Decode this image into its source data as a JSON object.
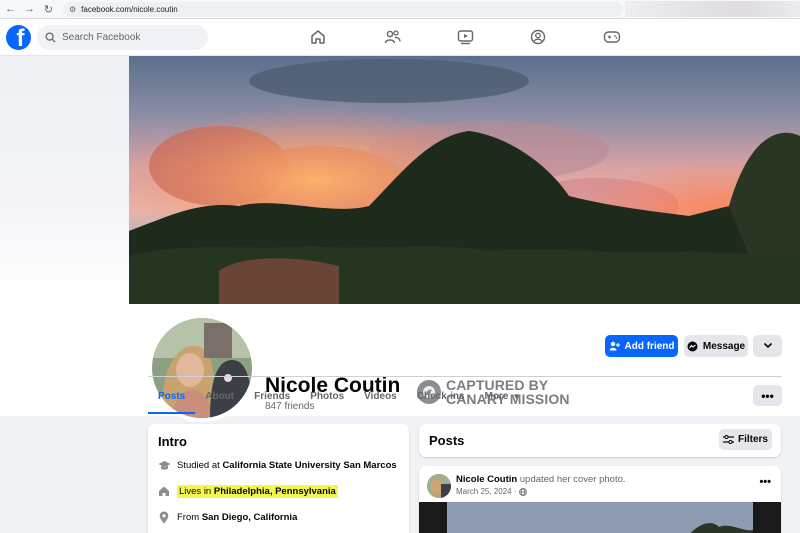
{
  "browser": {
    "url": "facebook.com/nicole.coutin"
  },
  "header": {
    "search_placeholder": "Search Facebook"
  },
  "profile": {
    "name": "Nicole Coutin",
    "friends": "847 friends",
    "badge_line1": "CAPTURED BY",
    "badge_line2": "CANARY MISSION"
  },
  "actions": {
    "add_friend": "Add friend",
    "message": "Message"
  },
  "tabs": [
    "Posts",
    "About",
    "Friends",
    "Photos",
    "Videos",
    "Check-ins",
    "More"
  ],
  "intro": {
    "title": "Intro",
    "education_prefix": "Studied at ",
    "education_school": "California State University San Marcos",
    "lives_prefix": "Lives in ",
    "lives_place": "Philadelphia, Pennsylvania",
    "from_prefix": "From ",
    "from_place": "San Diego, California"
  },
  "posts": {
    "title": "Posts",
    "filters": "Filters",
    "post_author": "Nicole Coutin",
    "post_action": " updated her cover photo.",
    "post_date": "March 25, 2024 ·"
  },
  "colors": {
    "accent": "#0866ff",
    "highlight": "#f6f74c"
  }
}
